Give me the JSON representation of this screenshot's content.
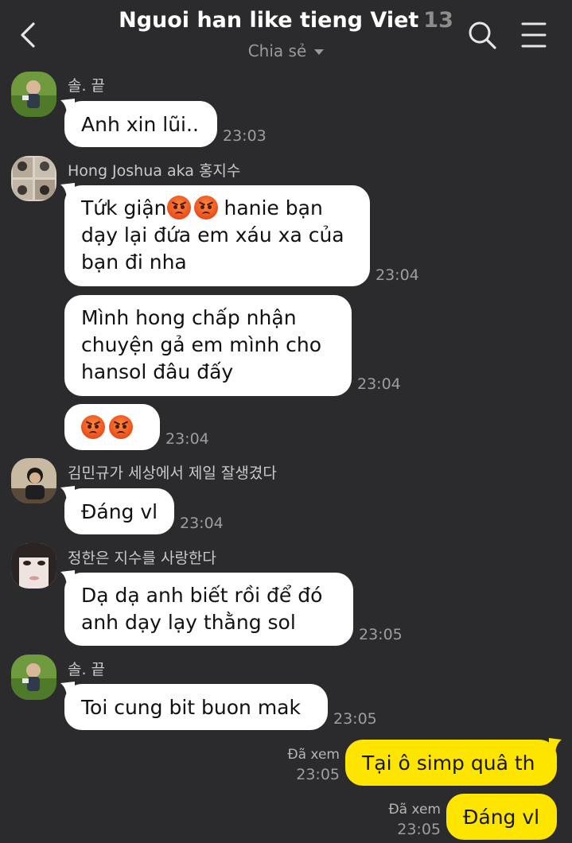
{
  "header": {
    "title": "Nguoi han like tieng Viet",
    "member_count": "13",
    "subtitle": "Chia sẻ"
  },
  "messages": {
    "m1": {
      "sender": "솔. 끝",
      "text": "Anh xin lũi..",
      "time": "23:03"
    },
    "m2": {
      "sender": "Hong Joshua aka 홍지수",
      "b1": {
        "l1a": "Tứk giận",
        "l1b": " hanie bạn",
        "l2": "dạy lại đứa em xáu xa của",
        "l3": "bạn đi nha",
        "time": "23:04"
      },
      "b2": {
        "l1": "Mình hong chấp nhận",
        "l2": "chuyện gả em mình cho",
        "l3": "hansol đâu đấy",
        "time": "23:04"
      },
      "b3": {
        "time": "23:04"
      }
    },
    "m3": {
      "sender": "김민규가 세상에서 제일 잘생겼다",
      "text": "Đáng vl",
      "time": "23:04"
    },
    "m4": {
      "sender": "정한은 지수를 사랑한다",
      "l1": "Dạ dạ anh biết rồi để đó",
      "l2": "anh dạy lạy thằng sol",
      "time": "23:05"
    },
    "m5": {
      "sender": "솔. 끝",
      "text": "Toi cung bit buon mak",
      "time": "23:05"
    },
    "mine1": {
      "read": "Đã xem",
      "time": "23:05",
      "text": "Tại ô simp quâ th"
    },
    "mine2": {
      "read": "Đã xem",
      "time": "23:05",
      "text": "Đáng vl"
    }
  },
  "colors": {
    "background": "#2b2b2d",
    "bubble_other": "#ffffff",
    "bubble_mine": "#fee500"
  },
  "icons": [
    "back-arrow-icon",
    "search-icon",
    "menu-icon",
    "angry-face-emoji"
  ]
}
